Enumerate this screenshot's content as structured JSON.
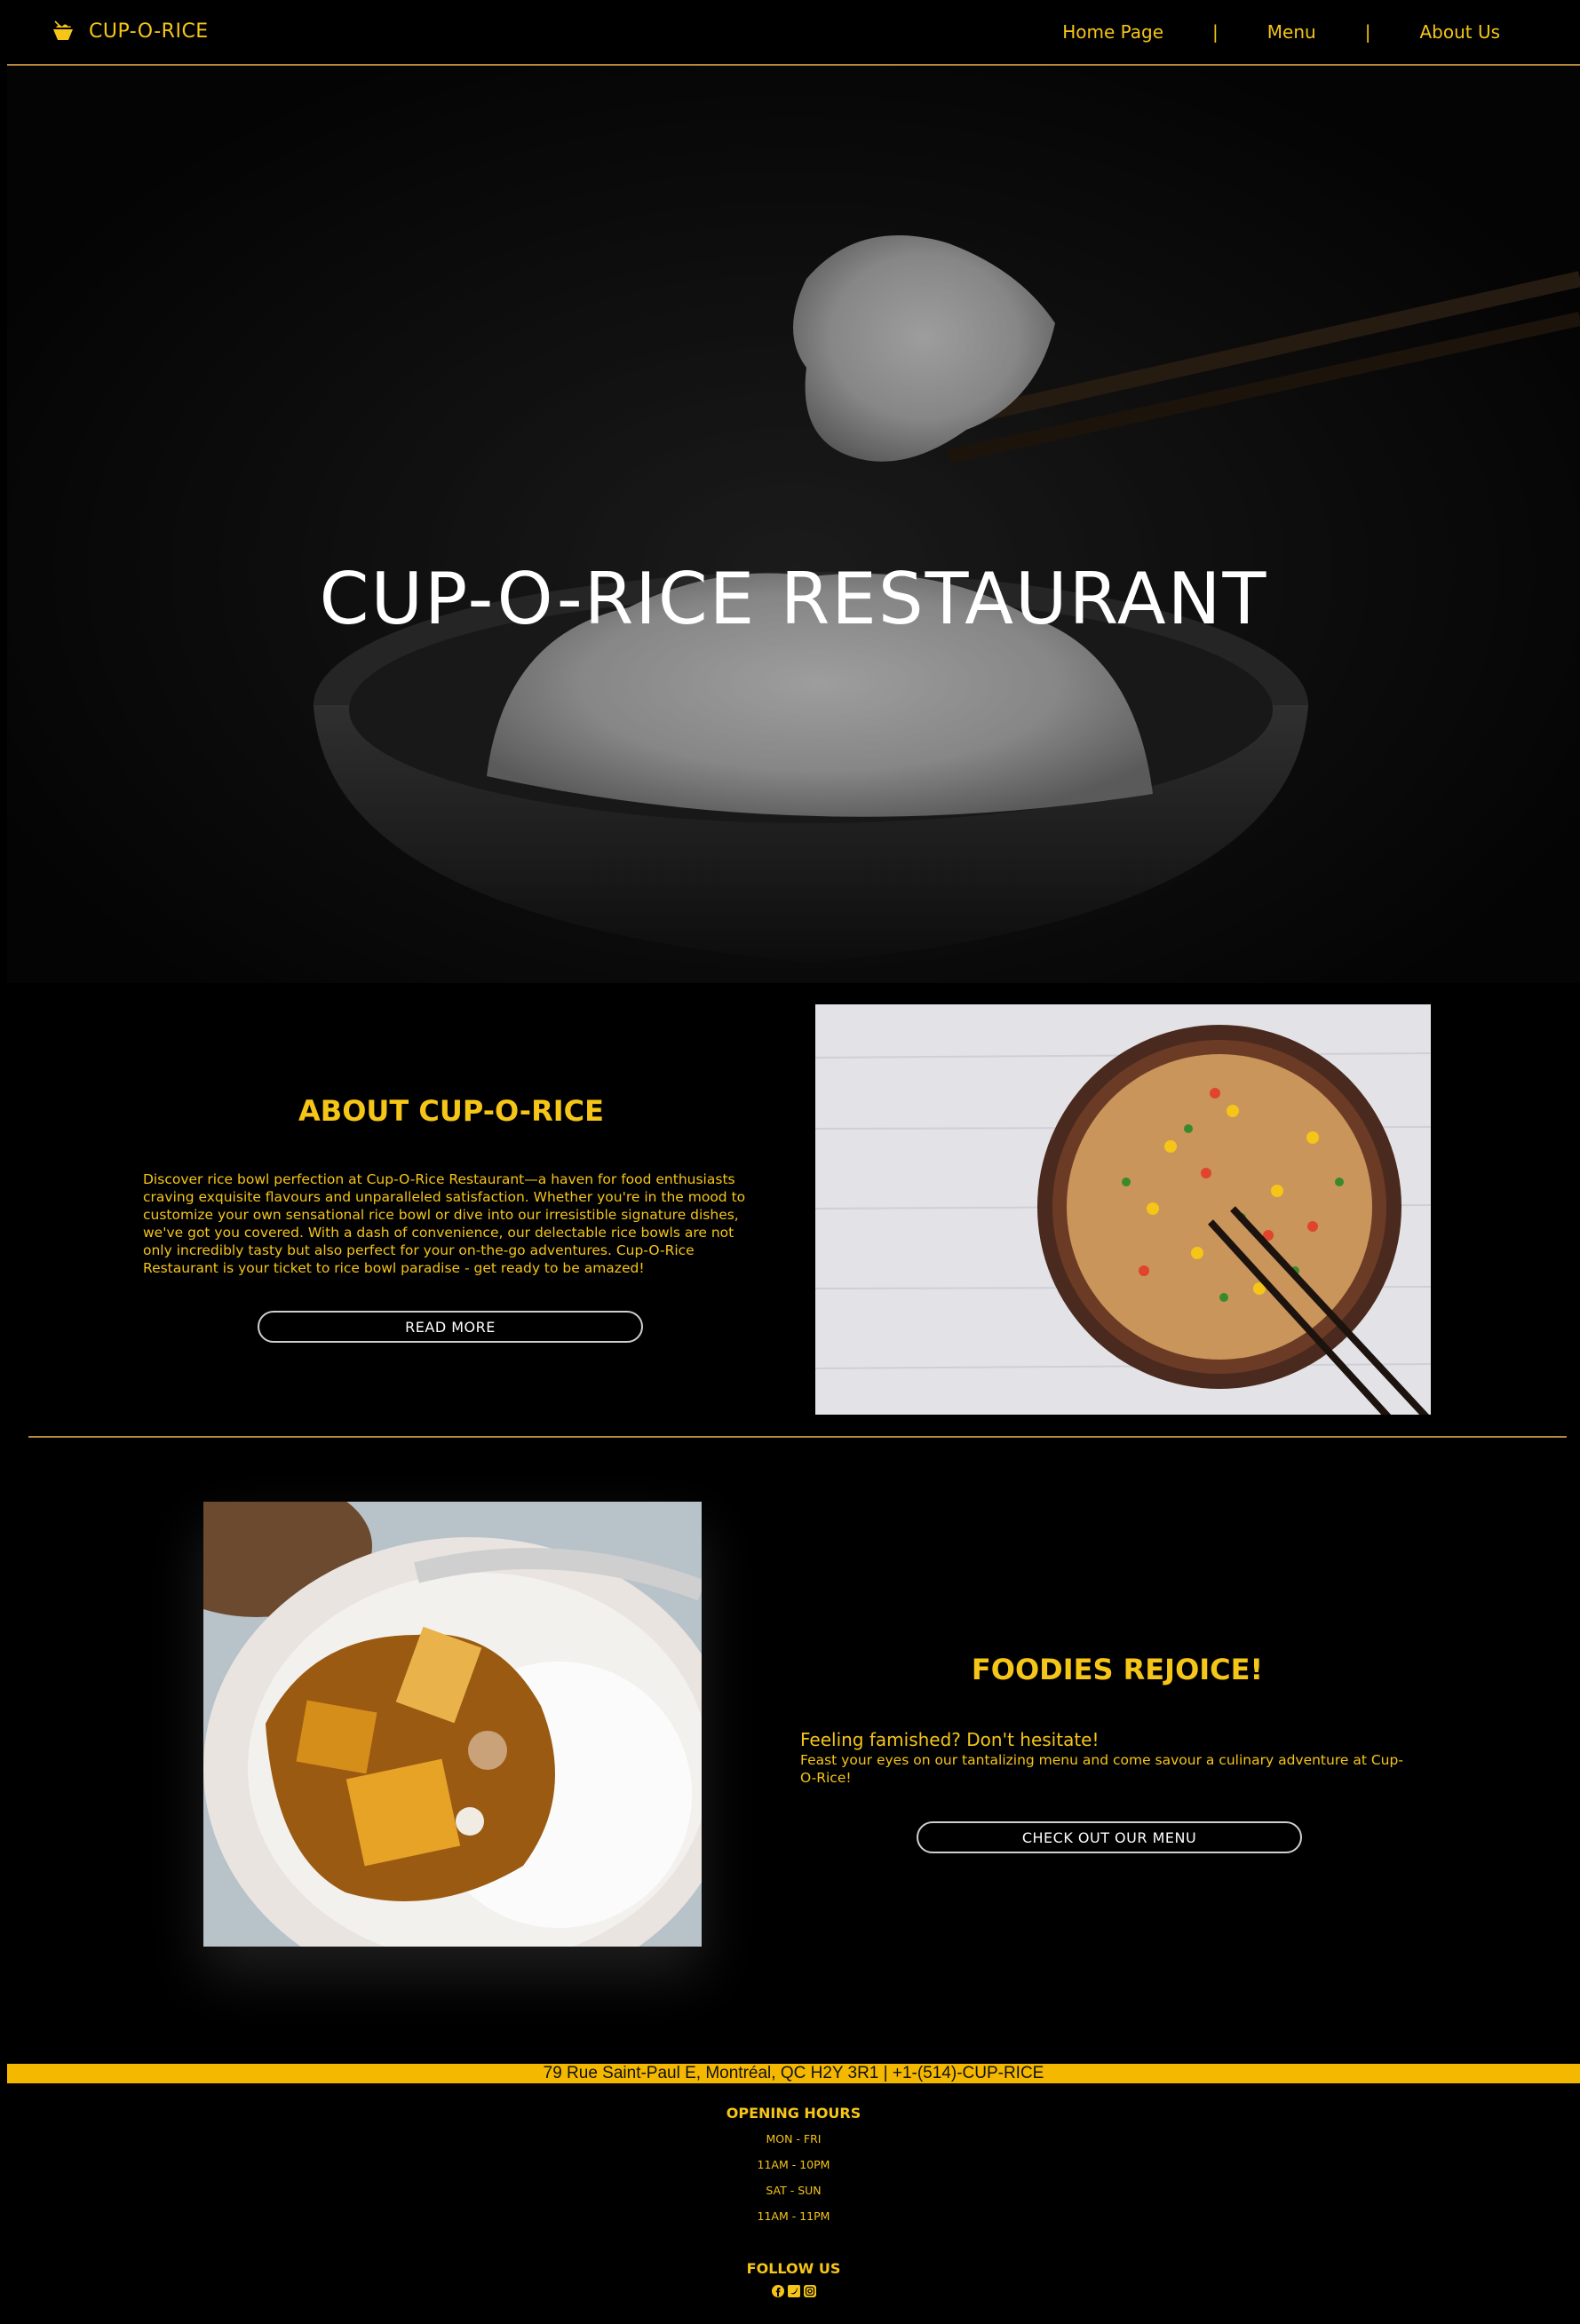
{
  "header": {
    "brand": "CUP-O-RICE",
    "nav": [
      "Home Page",
      "Menu",
      "About Us"
    ],
    "separator": "|"
  },
  "hero": {
    "title": "CUP-O-RICE RESTAURANT"
  },
  "about": {
    "title": "ABOUT CUP-O-RICE",
    "text": "Discover rice bowl perfection at Cup-O-Rice Restaurant—a haven for food enthusiasts craving exquisite flavours and unparalleled satisfaction. Whether you're in the mood to customize your own sensational rice bowl or dive into our irresistible signature dishes, we've got you covered. With a dash of convenience, our delectable rice bowls are not only incredibly tasty but also perfect for your on-the-go adventures. Cup-O-Rice Restaurant is your ticket to rice bowl paradise - get ready to be amazed!",
    "button": "READ MORE"
  },
  "foodies": {
    "title": "FOODIES REJOICE!",
    "subtitle": "Feeling famished? Don't hesitate!",
    "text": "Feast your eyes on our tantalizing menu and come savour a culinary adventure at Cup-O-Rice!",
    "button": "CHECK OUT OUR MENU"
  },
  "footer": {
    "address": "79 Rue Saint-Paul E, Montréal, QC H2Y 3R1 | +1-(514)-CUP-RICE",
    "hours_title": "OPENING HOURS",
    "hours": [
      "MON - FRI",
      "11AM - 10PM",
      "SAT - SUN",
      "11AM - 11PM"
    ],
    "follow_title": "FOLLOW US",
    "social": [
      "facebook-icon",
      "twitter-icon",
      "instagram-icon"
    ]
  },
  "colors": {
    "accent": "#f5c518",
    "background": "#000000",
    "divider": "#b58a3c",
    "address_bar": "#f5b800"
  }
}
